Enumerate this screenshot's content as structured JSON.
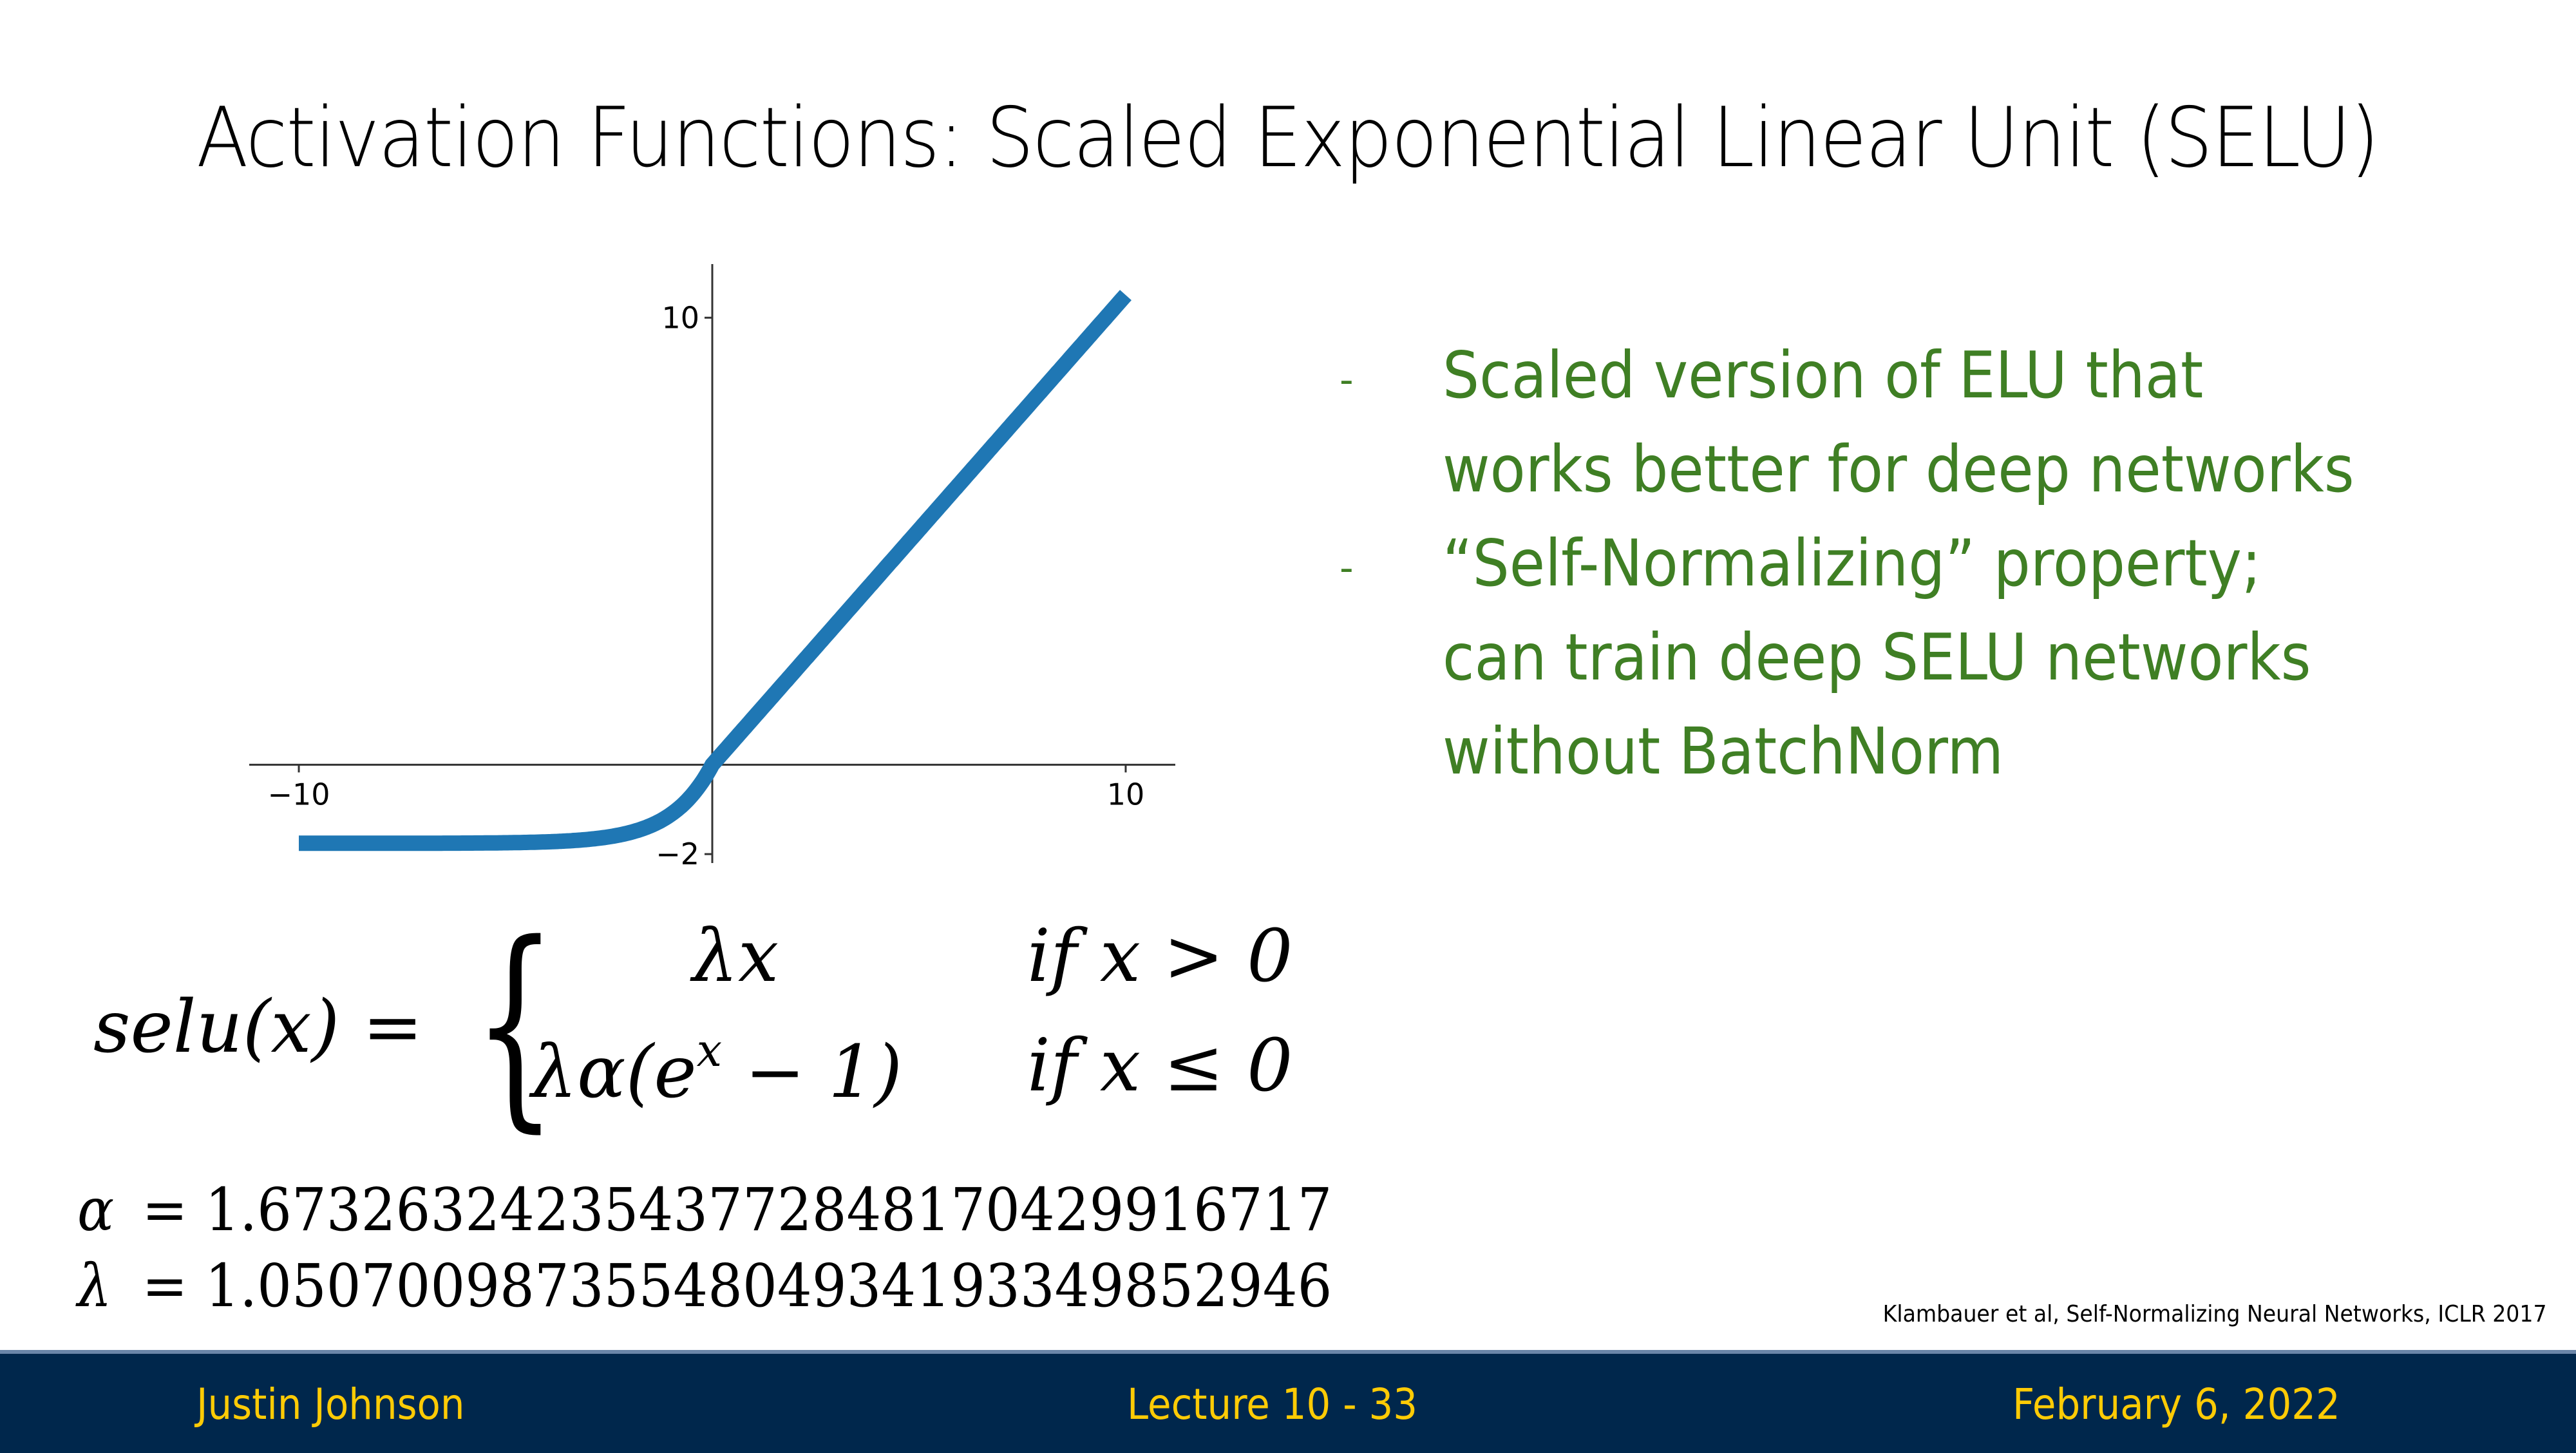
{
  "slide": {
    "title": "Activation Functions: Scaled Exponential Linear Unit (SELU)",
    "bullets": [
      {
        "marker": "-",
        "text": "Scaled version of ELU that\nworks better for deep networks"
      },
      {
        "marker": "-",
        "text": "“Self-Normalizing” property;\ncan train deep SELU networks\nwithout BatchNorm"
      }
    ],
    "formula": {
      "lhs": "selu(x) =",
      "case1_expr": "λx",
      "case1_cond": "if x > 0",
      "case2_expr_pre": "λα(e",
      "case2_expr_sup": "x",
      "case2_expr_post": " − 1)",
      "case2_cond": "if x ≤ 0"
    },
    "constants": [
      {
        "symbol": "α",
        "eq": "=",
        "value": "1.6732632423543772848170429916717"
      },
      {
        "symbol": "λ",
        "eq": "=",
        "value": "1.0507009873554804934193349852946"
      }
    ],
    "citation": "Klambauer et al, Self-Normalizing Neural Networks, ICLR 2017",
    "footer": {
      "author": "Justin Johnson",
      "lecture": "Lecture 10 - 33",
      "date": "February 6, 2022"
    }
  },
  "colors": {
    "bullet_text": "#3f7f24",
    "footer_bg": "#00274c",
    "footer_text": "#ffcb05",
    "line": "#1f77b4"
  },
  "chart_data": {
    "type": "line",
    "title": "",
    "xlabel": "",
    "ylabel": "",
    "function": "selu",
    "params": {
      "alpha": 1.6732632423543772,
      "lambda": 1.0507009873554805
    },
    "xlim": [
      -11.2,
      11.2
    ],
    "ylim": [
      -2.2,
      11.2
    ],
    "x_range": [
      -10,
      10
    ],
    "x_ticks": [
      -10,
      10
    ],
    "x_tick_labels": [
      "−10",
      "10"
    ],
    "y_ticks": [
      -2,
      10
    ],
    "y_tick_labels": [
      "−2",
      "10"
    ],
    "grid": false,
    "spines": "centered at origin",
    "series": [
      {
        "name": "selu",
        "x": [
          -10,
          -8,
          -6,
          -5,
          -4,
          -3,
          -2.5,
          -2,
          -1.5,
          -1,
          -0.5,
          0,
          1,
          2,
          4,
          6,
          8,
          10
        ],
        "y": [
          -1.758,
          -1.757,
          -1.754,
          -1.746,
          -1.726,
          -1.67,
          -1.614,
          -1.52,
          -1.367,
          -1.111,
          -0.692,
          0,
          1.051,
          2.101,
          4.203,
          6.304,
          8.406,
          10.507
        ]
      }
    ]
  }
}
